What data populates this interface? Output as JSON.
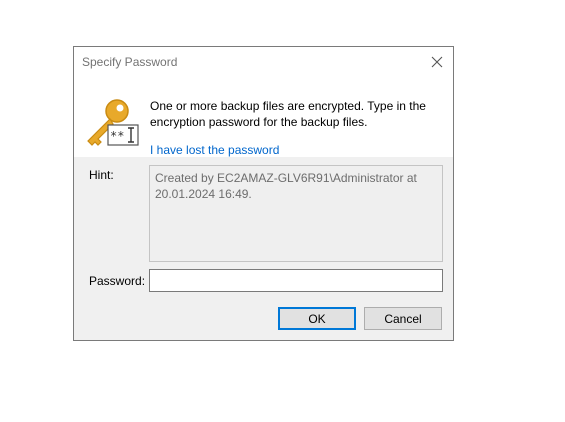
{
  "dialog": {
    "title": "Specify Password",
    "message": "One or more backup files are encrypted. Type in the encryption password for the backup files.",
    "lost_password_link": "I have lost the password",
    "hint_label": "Hint:",
    "hint_text": "Created by EC2AMAZ-GLV6R91\\Administrator at 20.01.2024 16:49.",
    "password_label": "Password:",
    "password_value": "",
    "ok_label": "OK",
    "cancel_label": "Cancel"
  },
  "icons": {
    "close": "close-icon",
    "key": "key-password-icon"
  },
  "colors": {
    "link": "#0066cc",
    "focus_border": "#0078d7",
    "key_gold": "#e8a92a"
  }
}
